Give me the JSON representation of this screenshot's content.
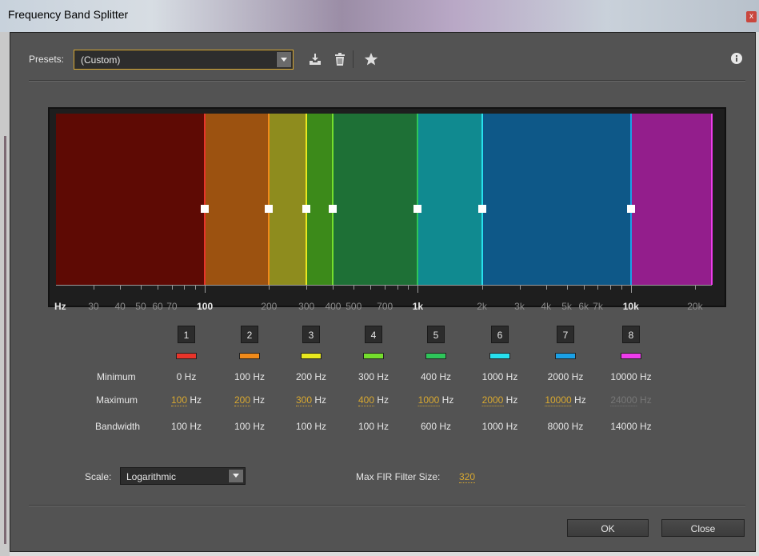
{
  "window": {
    "title": "Frequency Band Splitter",
    "close_glyph": "x"
  },
  "presets": {
    "label": "Presets:",
    "value": "(Custom)"
  },
  "toolbar_icons": [
    "save-preset-icon",
    "delete-preset-icon",
    "favorite-star-icon"
  ],
  "graph": {
    "axis_unit_label": "Hz",
    "tick_labels": [
      "30",
      "40",
      "50",
      "60",
      "70",
      "100",
      "200",
      "300",
      "400",
      "500",
      "700",
      "1k",
      "2k",
      "3k",
      "4k",
      "5k",
      "6k",
      "7k",
      "10k",
      "20k"
    ],
    "bold_ticks": [
      "100",
      "1k",
      "10k"
    ],
    "scale": "logarithmic",
    "range_hz": [
      20,
      24000
    ]
  },
  "bands": [
    {
      "number": "1",
      "color": "#e8342a",
      "fill": "#5e0a04",
      "minimum": "0 Hz",
      "maximum_num": "100",
      "maximum_unit": " Hz",
      "bandwidth": "100 Hz"
    },
    {
      "number": "2",
      "color": "#f08a1a",
      "fill": "#9c5210",
      "minimum": "100 Hz",
      "maximum_num": "200",
      "maximum_unit": " Hz",
      "bandwidth": "100 Hz"
    },
    {
      "number": "3",
      "color": "#e8e81e",
      "fill": "#8e8c1e",
      "minimum": "200 Hz",
      "maximum_num": "300",
      "maximum_unit": " Hz",
      "bandwidth": "100 Hz"
    },
    {
      "number": "4",
      "color": "#74de2c",
      "fill": "#3c8a1a",
      "minimum": "300 Hz",
      "maximum_num": "400",
      "maximum_unit": " Hz",
      "bandwidth": "100 Hz"
    },
    {
      "number": "5",
      "color": "#2ec65a",
      "fill": "#1e7036",
      "minimum": "400 Hz",
      "maximum_num": "1000",
      "maximum_unit": " Hz",
      "bandwidth": "600 Hz"
    },
    {
      "number": "6",
      "color": "#27e0ee",
      "fill": "#108a90",
      "minimum": "1000 Hz",
      "maximum_num": "2000",
      "maximum_unit": " Hz",
      "bandwidth": "1000 Hz"
    },
    {
      "number": "7",
      "color": "#1aa0e6",
      "fill": "#0e5888",
      "minimum": "2000 Hz",
      "maximum_num": "10000",
      "maximum_unit": " Hz",
      "bandwidth": "8000 Hz"
    },
    {
      "number": "8",
      "color": "#ee3cec",
      "fill": "#931e8c",
      "minimum": "10000 Hz",
      "maximum_num": "24000",
      "maximum_unit": " Hz",
      "bandwidth": "14000 Hz"
    }
  ],
  "rows": {
    "minimum": "Minimum",
    "maximum": "Maximum",
    "bandwidth": "Bandwidth"
  },
  "scale": {
    "label": "Scale:",
    "value": "Logarithmic"
  },
  "fir": {
    "label": "Max FIR Filter Size:",
    "value": "320"
  },
  "buttons": {
    "ok": "OK",
    "close": "Close"
  }
}
